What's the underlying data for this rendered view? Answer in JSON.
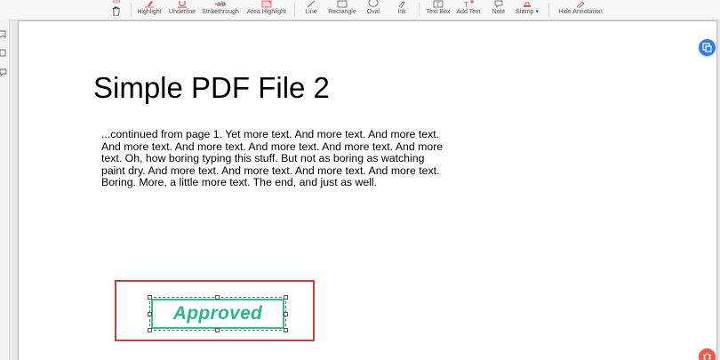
{
  "toolbar": {
    "tools": [
      {
        "id": "hand",
        "label": "",
        "icon": "hand-icon"
      },
      {
        "id": "highlight",
        "label": "Highlight",
        "icon": "highlight-icon"
      },
      {
        "id": "underline",
        "label": "Underline",
        "icon": "underline-icon"
      },
      {
        "id": "strikethrough",
        "label": "Strikethrough",
        "icon": "strikethrough-icon"
      },
      {
        "id": "area-highlight",
        "label": "Area Highlight",
        "icon": "area-highlight-icon"
      },
      {
        "id": "line",
        "label": "Line",
        "icon": "line-icon"
      },
      {
        "id": "rectangle",
        "label": "Rectangle",
        "icon": "rectangle-icon"
      },
      {
        "id": "oval",
        "label": "Oval",
        "icon": "oval-icon"
      },
      {
        "id": "ink",
        "label": "Ink",
        "icon": "ink-icon"
      },
      {
        "id": "text-box",
        "label": "Text Box",
        "icon": "text-box-icon"
      },
      {
        "id": "add-text",
        "label": "Add Text",
        "icon": "add-text-icon"
      },
      {
        "id": "note",
        "label": "Note",
        "icon": "note-icon"
      },
      {
        "id": "stamp",
        "label": "Stamp ▾",
        "icon": "stamp-icon"
      },
      {
        "id": "hide-annotation",
        "label": "Hide Annotation",
        "icon": "hide-annotation-icon"
      }
    ]
  },
  "left_rail": {
    "icons": [
      "bookmark-icon",
      "page-icon",
      "comment-icon"
    ]
  },
  "document": {
    "title": "Simple PDF File 2",
    "body_lines": [
      "...continued from page 1. Yet more text. And more text. And more text.",
      "And more text. And more text. And more text. And more text. And more",
      "text. Oh, how boring typing this stuff. But not as boring as watching",
      "paint dry. And more text. And more text. And more text. And more text.",
      "Boring.  More, a little more text. The end, and just as well."
    ]
  },
  "stamp": {
    "text": "Approved",
    "text_color": "#27b986",
    "frame_color": "#e2362f"
  },
  "colors": {
    "accent_red": "#e2362f",
    "accent_blue": "#2f7ee8",
    "stamp_green": "#2fbf8f"
  },
  "floating_buttons": {
    "top_icon": "export-icon",
    "bottom_icon": "bug-icon"
  }
}
